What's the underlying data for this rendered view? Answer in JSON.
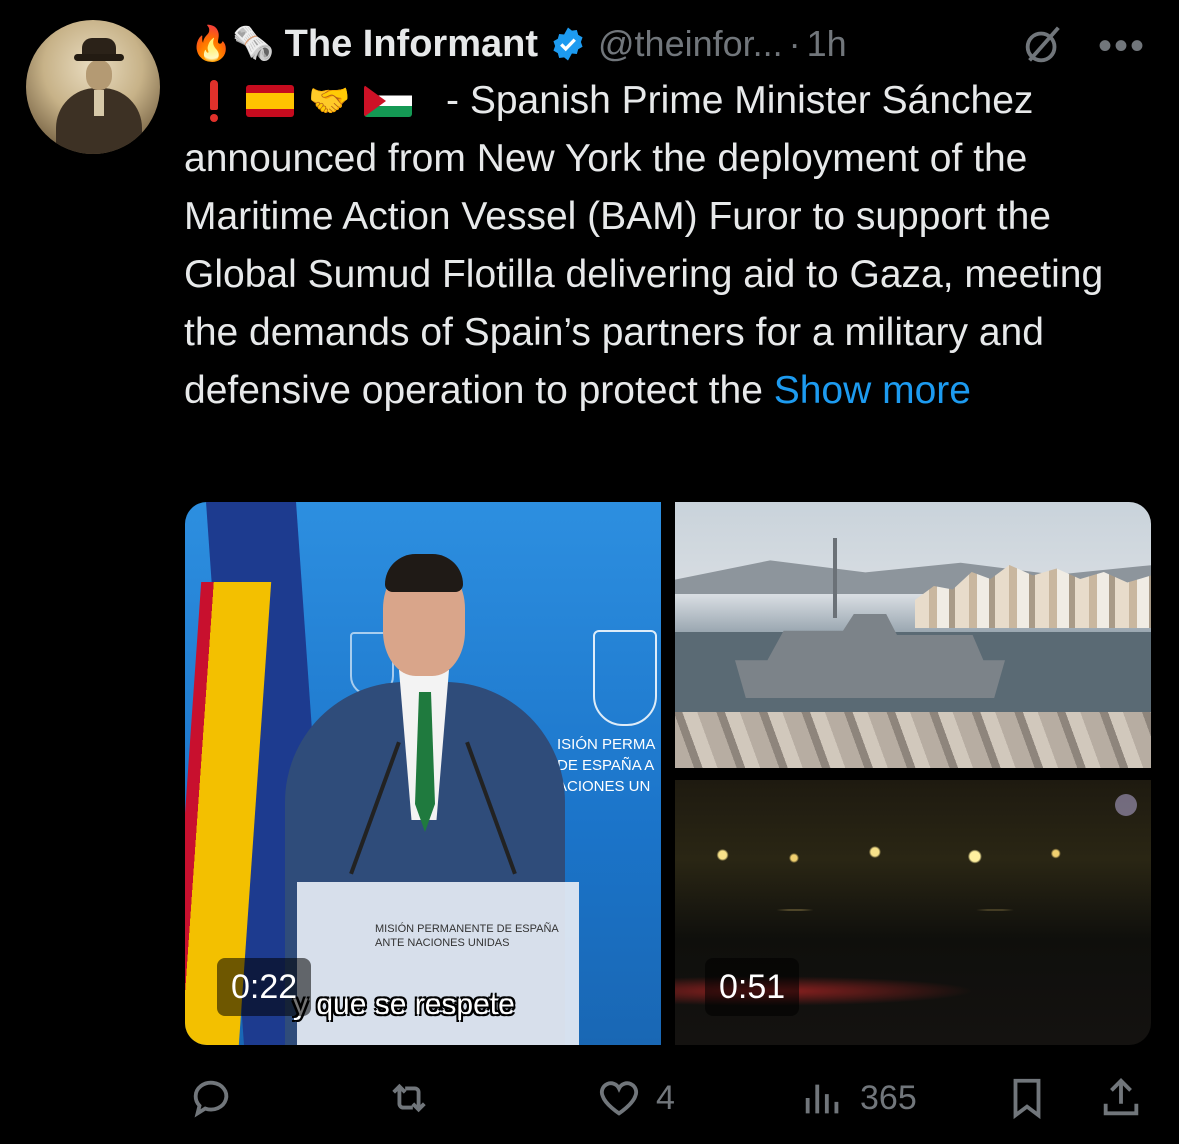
{
  "author": {
    "emojis": "🔥🗞️",
    "name": "The Informant",
    "handle": "@theinfor...",
    "separator": "·",
    "time": "1h"
  },
  "tweet": {
    "prefix_emojis": {
      "handshake": "🤝"
    },
    "first_line": "- Spanish Prime Minister Sánchez",
    "body": "announced from New York the deployment of the Maritime Action Vessel (BAM) Furor to support the Global Sumud Flotilla delivering aid to Gaza, meeting the demands of Spain’s partners for a military and defensive operation to protect the ",
    "show_more": "Show more"
  },
  "media": {
    "video1": {
      "duration": "0:22",
      "caption": "y que se respete",
      "wall_text": [
        "ISIÓN PERMA",
        "DE ESPAÑA A",
        "ACIONES UN"
      ],
      "podium_text": [
        "MISIÓN PERMANENTE DE ESPAÑA",
        "ANTE NACIONES UNIDAS"
      ]
    },
    "image2": {},
    "video2": {
      "duration": "0:51"
    }
  },
  "actions": {
    "reply_count": "",
    "repost_count": "",
    "like_count": "4",
    "views_count": "365"
  },
  "colors": {
    "accent": "#1d9bf0",
    "muted": "#71767b",
    "text": "#e7e9ea",
    "background": "#000000"
  },
  "icons": [
    "fire-emoji",
    "newspaper-emoji",
    "verified-badge-icon",
    "grok-icon",
    "more-icon",
    "exclamation-icon",
    "spain-flag",
    "handshake-emoji",
    "palestine-flag",
    "reply-icon",
    "repost-icon",
    "like-icon",
    "views-icon",
    "bookmark-icon",
    "share-icon"
  ]
}
